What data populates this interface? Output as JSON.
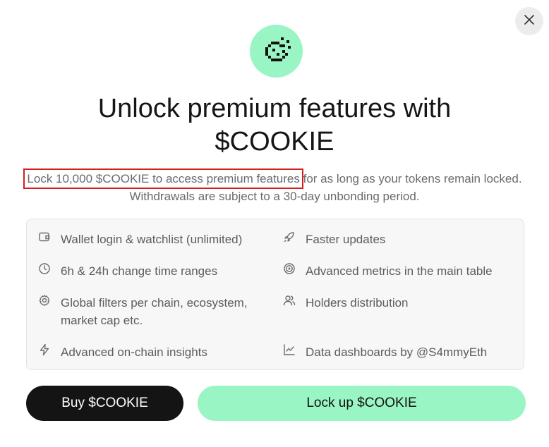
{
  "modal": {
    "title": "Unlock premium features with $COOKIE",
    "description_highlight": "Lock 10,000 $COOKIE to access premium features",
    "description_rest": " for as long as your tokens remain locked. Withdrawals are subject to a 30-day unbonding period.",
    "accent_color": "#9af5c4",
    "highlight_color": "#d21f1f"
  },
  "features": [
    {
      "icon": "wallet-icon",
      "label": "Wallet login & watchlist (unlimited)"
    },
    {
      "icon": "rocket-icon",
      "label": "Faster updates"
    },
    {
      "icon": "clock-icon",
      "label": "6h & 24h change time ranges"
    },
    {
      "icon": "target-icon",
      "label": "Advanced metrics in the main table"
    },
    {
      "icon": "gear-icon",
      "label": "Global filters per chain, ecosystem, market cap etc."
    },
    {
      "icon": "users-icon",
      "label": "Holders distribution"
    },
    {
      "icon": "lightning-icon",
      "label": "Advanced on-chain insights"
    },
    {
      "icon": "line-chart-icon",
      "label": "Data dashboards by @S4mmyEth"
    }
  ],
  "buttons": {
    "buy_label": "Buy $COOKIE",
    "lock_label": "Lock up $COOKIE"
  }
}
